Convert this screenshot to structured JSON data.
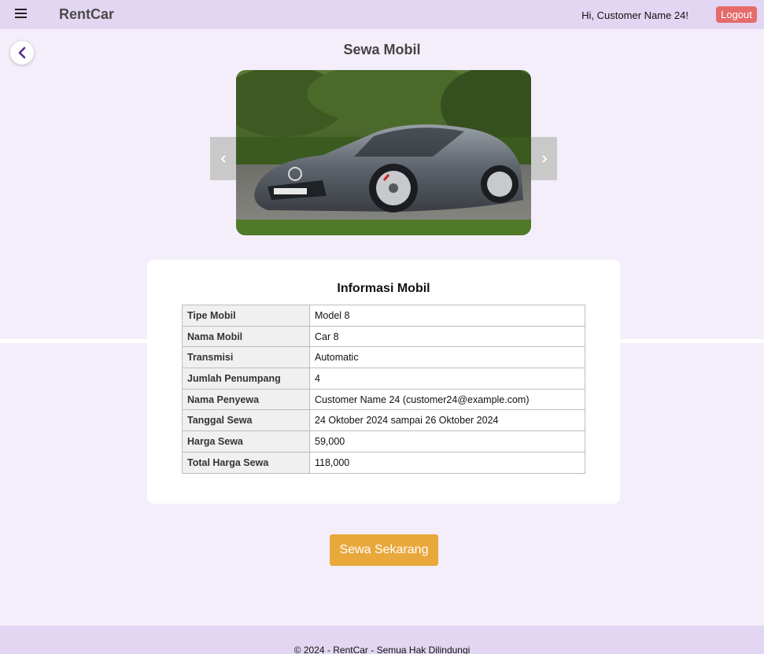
{
  "header": {
    "brand": "RentCar",
    "greeting": "Hi, Customer Name 24!",
    "logout_label": "Logout"
  },
  "page": {
    "title": "Sewa Mobil"
  },
  "carousel": {
    "prev_icon": "chevron-left-icon",
    "next_icon": "chevron-right-icon"
  },
  "info": {
    "title": "Informasi Mobil",
    "rows": [
      {
        "label": "Tipe Mobil",
        "value": "Model 8"
      },
      {
        "label": "Nama Mobil",
        "value": "Car 8"
      },
      {
        "label": "Transmisi",
        "value": "Automatic"
      },
      {
        "label": "Jumlah Penumpang",
        "value": "4"
      },
      {
        "label": "Nama Penyewa",
        "value": "Customer Name 24 (customer24@example.com)"
      },
      {
        "label": "Tanggal Sewa",
        "value": "24 Oktober 2024 sampai 26 Oktober 2024"
      },
      {
        "label": "Harga Sewa",
        "value": "59,000"
      },
      {
        "label": "Total Harga Sewa",
        "value": "118,000"
      }
    ]
  },
  "actions": {
    "rent_now_label": "Sewa Sekarang"
  },
  "footer": {
    "text": "© 2024 - RentCar - Semua Hak Dilindungi"
  },
  "colors": {
    "header_bg": "#e3d6f2",
    "page_bg": "#f4eefa",
    "logout_bg": "#e66b6b",
    "cta_bg": "#e9a83c",
    "back_arrow": "#5a2d91"
  }
}
